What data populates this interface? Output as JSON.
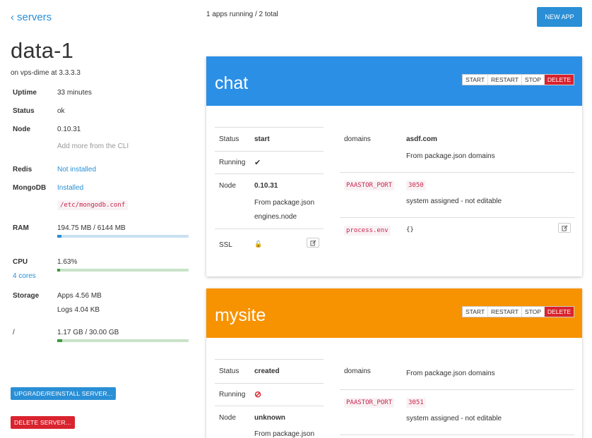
{
  "nav": {
    "back_label": "servers"
  },
  "server": {
    "name": "data-1",
    "host_line": "on vps-dime at 3.3.3.3",
    "uptime_label": "Uptime",
    "uptime": "33 minutes",
    "status_label": "Status",
    "status": "ok",
    "node_label": "Node",
    "node": "0.10.31",
    "node_hint": "Add more from the CLI",
    "redis_label": "Redis",
    "redis": "Not installed",
    "mongo_label": "MongoDB",
    "mongo": "Installed",
    "mongo_conf": "/etc/mongodb.conf",
    "ram_label": "RAM",
    "ram": "194.75 MB / 6144 MB",
    "ram_fraction": 0.032,
    "cpu_label": "CPU",
    "cpu": "1.63%",
    "cpu_cores": "4 cores",
    "cpu_fraction": 0.0163,
    "storage_label": "Storage",
    "storage_apps": "Apps 4.56 MB",
    "storage_logs": "Logs 4.04 KB",
    "disk_label": "/",
    "disk": "1.17 GB / 30.00 GB",
    "disk_fraction": 0.039,
    "upgrade_label": "UPGRADE/REINSTALL SERVER...",
    "delete_label": "DELETE SERVER..."
  },
  "header": {
    "apps_count": "1 apps running / 2 total",
    "new_app_label": "NEW APP"
  },
  "controls": {
    "start": "START",
    "restart": "RESTART",
    "stop": "STOP",
    "delete": "DELETE"
  },
  "apps": [
    {
      "name": "chat",
      "color": "#2b8fe6",
      "status_label": "Status",
      "status": "start",
      "running_label": "Running",
      "running": "✔",
      "node_label": "Node",
      "node": "0.10.31",
      "node_hint_1": "From package.json",
      "node_hint_2": "engines.node",
      "ssl_label": "SSL",
      "ssl": "🔓",
      "domains_label": "domains",
      "domains": "asdf.com",
      "domains_hint": "From package.json domains",
      "port_key": "PAASTOR_PORT",
      "port": "3050",
      "port_hint": "system assigned - not editable",
      "env_key": "process.env",
      "env": "{}"
    },
    {
      "name": "mysite",
      "color": "#f79200",
      "status_label": "Status",
      "status": "created",
      "running_label": "Running",
      "running": "⊘",
      "node_label": "Node",
      "node": "unknown",
      "node_hint_1": "From package.json",
      "domains_label": "domains",
      "domains_hint": "From package.json domains",
      "port_key": "PAASTOR_PORT",
      "port": "3051",
      "port_hint": "system assigned - not editable"
    }
  ]
}
